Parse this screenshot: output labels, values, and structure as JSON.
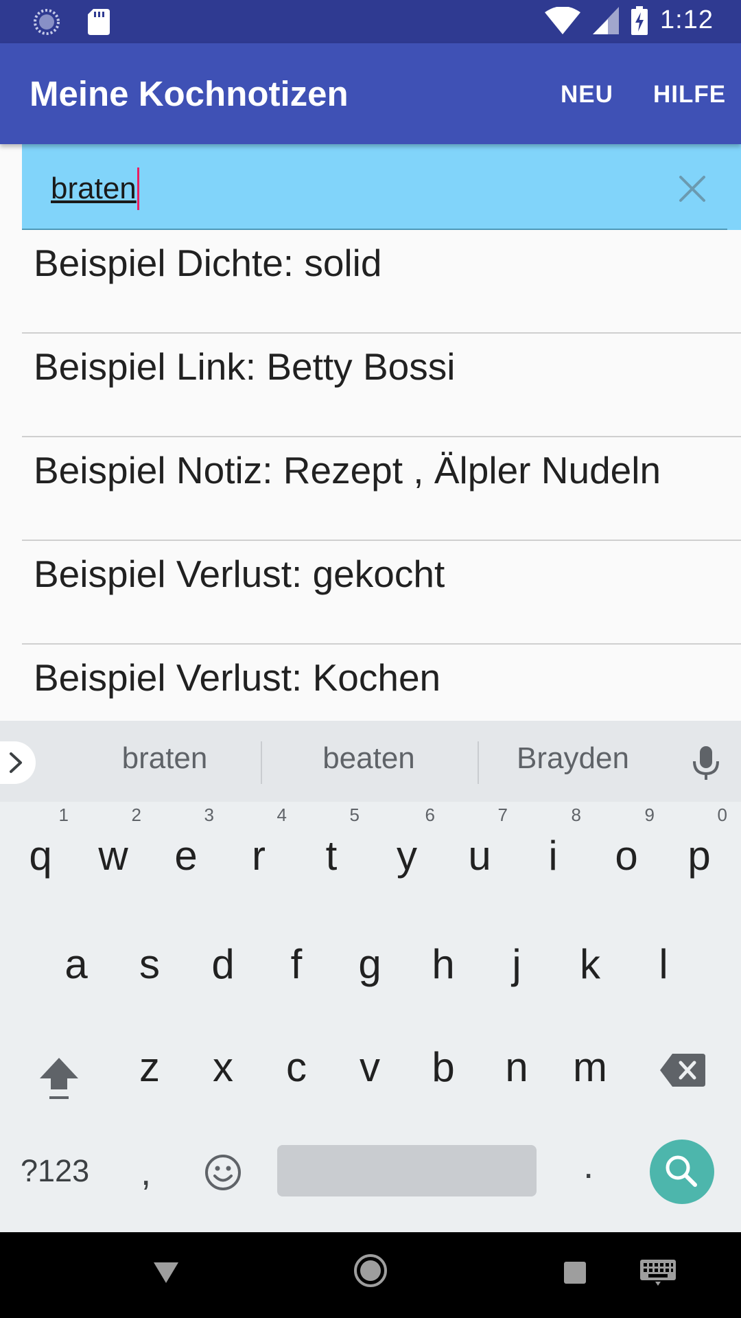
{
  "status_bar": {
    "time": "1:12"
  },
  "app_bar": {
    "title": "Meine Kochnotizen",
    "action_new": "NEU",
    "action_help": "HILFE"
  },
  "search": {
    "value": "braten"
  },
  "results": [
    "Beispiel Dichte: solid",
    "Beispiel Link: Betty Bossi",
    "Beispiel Notiz: Rezept , Älpler Nudeln",
    "Beispiel Verlust: gekocht",
    "Beispiel Verlust: Kochen"
  ],
  "keyboard": {
    "suggestions": [
      "braten",
      "beaten",
      "Brayden"
    ],
    "row1": [
      {
        "key": "q",
        "hint": "1"
      },
      {
        "key": "w",
        "hint": "2"
      },
      {
        "key": "e",
        "hint": "3"
      },
      {
        "key": "r",
        "hint": "4"
      },
      {
        "key": "t",
        "hint": "5"
      },
      {
        "key": "y",
        "hint": "6"
      },
      {
        "key": "u",
        "hint": "7"
      },
      {
        "key": "i",
        "hint": "8"
      },
      {
        "key": "o",
        "hint": "9"
      },
      {
        "key": "p",
        "hint": "0"
      }
    ],
    "row2": [
      "a",
      "s",
      "d",
      "f",
      "g",
      "h",
      "j",
      "k",
      "l"
    ],
    "row3": [
      "z",
      "x",
      "c",
      "v",
      "b",
      "n",
      "m"
    ],
    "symbols_label": "?123",
    "comma": ",",
    "period": "."
  },
  "colors": {
    "status_bar": "#2f3a91",
    "app_bar": "#3f51b5",
    "search_bg": "#81d4fa",
    "caret": "#e91e63",
    "search_key": "#4db6ac"
  },
  "icons": [
    "sync-icon",
    "sd-card-icon",
    "wifi-icon",
    "signal-icon",
    "battery-charging-icon",
    "close-icon",
    "chevron-right-icon",
    "mic-icon",
    "shift-icon",
    "backspace-icon",
    "emoji-icon",
    "search-icon",
    "nav-back-icon",
    "nav-home-icon",
    "nav-recent-icon",
    "keyboard-icon"
  ]
}
